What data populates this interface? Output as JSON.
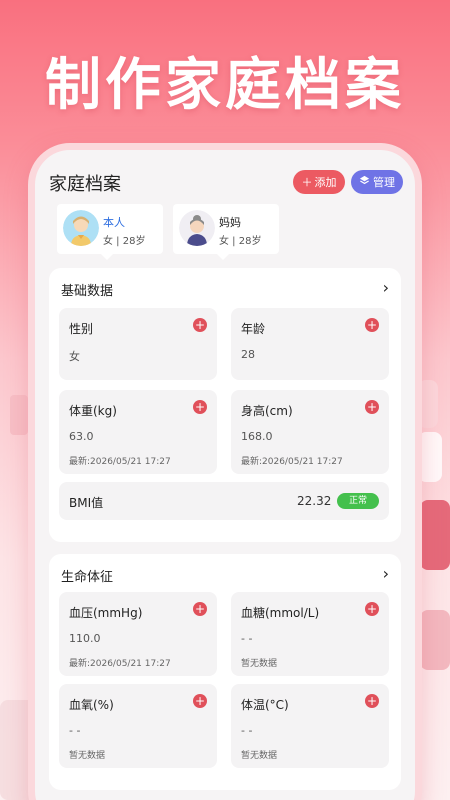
{
  "headline": "制作家庭档案",
  "app": {
    "title": "家庭档案",
    "add_label": "添加",
    "manage_label": "管理"
  },
  "members": [
    {
      "name": "本人",
      "info": "女 | 28岁",
      "active": true
    },
    {
      "name": "妈妈",
      "info": "女 | 28岁",
      "active": false
    }
  ],
  "basic": {
    "title": "基础数据",
    "gender": {
      "label": "性别",
      "value": "女"
    },
    "age": {
      "label": "年龄",
      "value": "28"
    },
    "weight": {
      "label": "体重(kg)",
      "value": "63.0",
      "time": "最新:2026/05/21 17:27"
    },
    "height": {
      "label": "身高(cm)",
      "value": "168.0",
      "time": "最新:2026/05/21 17:27"
    },
    "bmi": {
      "label": "BMI值",
      "value": "22.32",
      "status": "正常"
    }
  },
  "vitals": {
    "title": "生命体征",
    "bp": {
      "label": "血压(mmHg)",
      "value": "110.0",
      "time": "最新:2026/05/21 17:27"
    },
    "glucose": {
      "label": "血糖(mmol/L)",
      "value": "- -",
      "time": "暂无数据"
    },
    "oxygen": {
      "label": "血氧(%)",
      "value": "- -",
      "time": "暂无数据"
    },
    "temp": {
      "label": "体温(°C)",
      "value": "- -",
      "time": "暂无数据"
    }
  },
  "colors": {
    "accent_red": "#ec5a62",
    "accent_purple": "#6f73e6",
    "active_member": "#2f6fe0",
    "ok_green": "#44c04d"
  }
}
